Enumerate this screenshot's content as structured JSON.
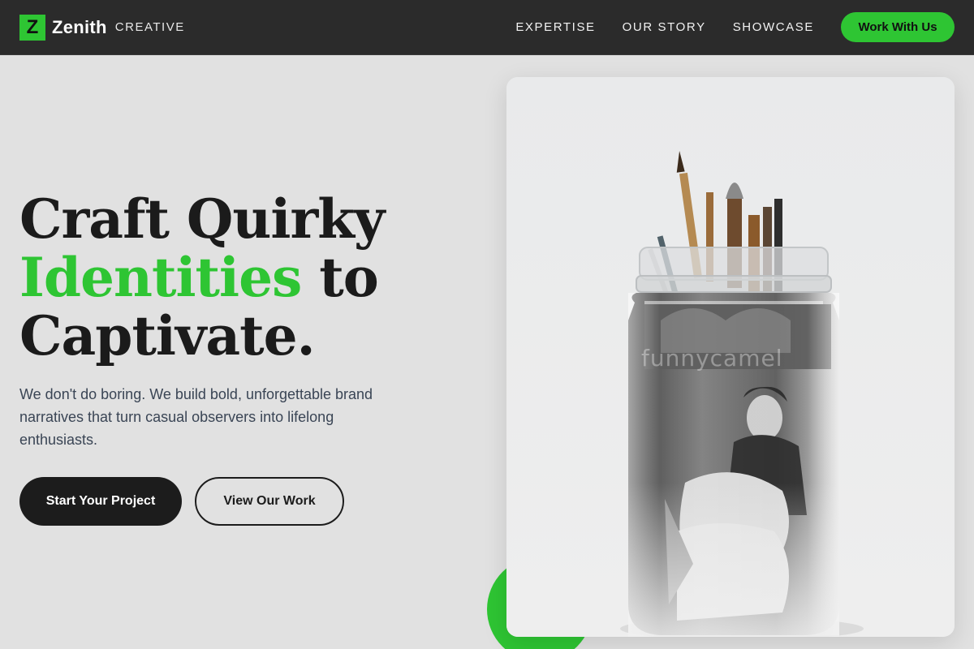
{
  "brand": {
    "mark": "Z",
    "name": "Zenith",
    "tagline": "CREATIVE",
    "accent_color": "#2ec533"
  },
  "nav": {
    "links": [
      "EXPERTISE",
      "OUR STORY",
      "SHOWCASE"
    ],
    "cta_label": "Work With Us"
  },
  "hero": {
    "title_line1": "Craft Quirky",
    "title_accent": "Identities",
    "title_line2_rest": " to",
    "title_line3": "Captivate.",
    "subtitle": "We don't do boring. We build bold, unforgettable brand narratives that turn casual observers into lifelong enthusiasts.",
    "primary_cta": "Start Your Project",
    "secondary_cta": "View Our Work",
    "image_watermark": "funnycamel"
  }
}
